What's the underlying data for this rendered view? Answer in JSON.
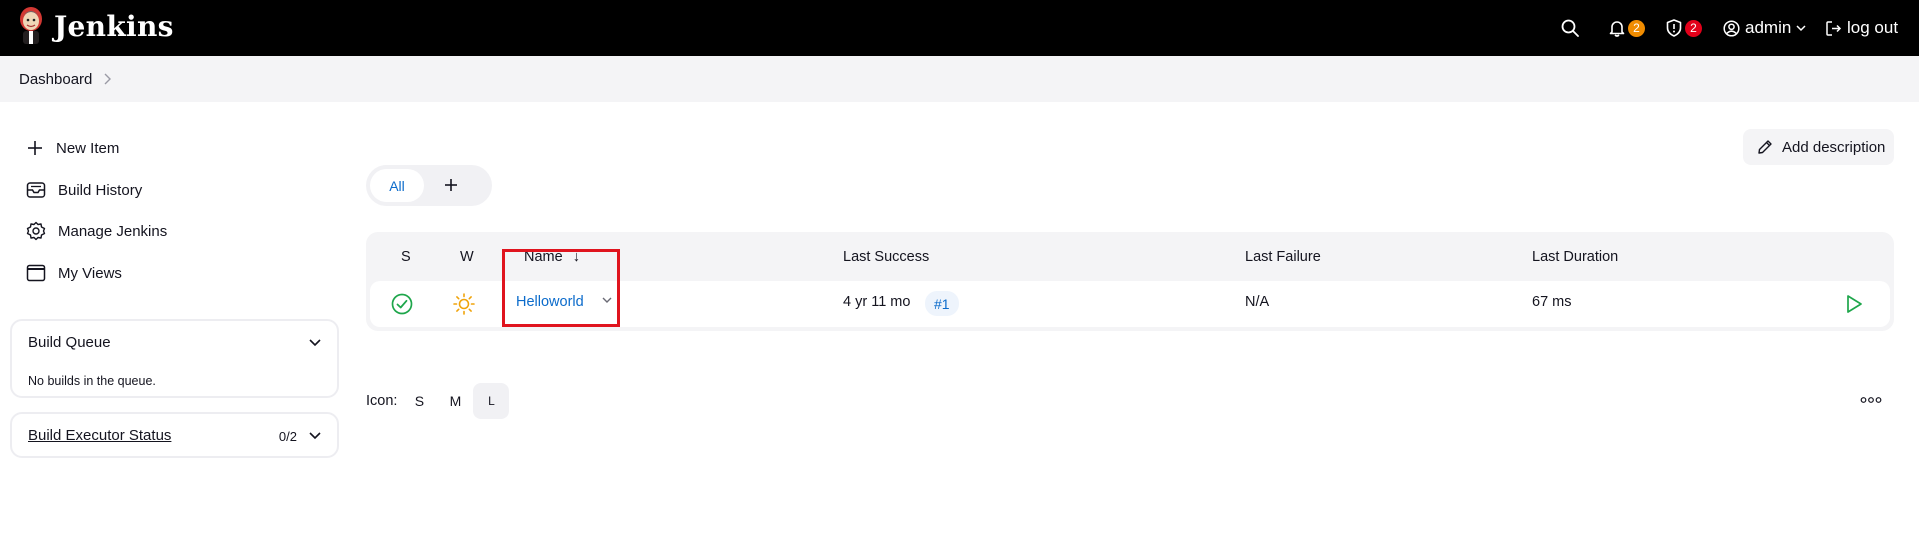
{
  "header": {
    "brand": "Jenkins",
    "notifications_count": "2",
    "security_count": "2",
    "user": "admin",
    "logout": "log out"
  },
  "breadcrumb": {
    "items": [
      "Dashboard"
    ]
  },
  "sidebar": {
    "items": [
      {
        "label": "New Item",
        "icon": "plus-icon"
      },
      {
        "label": "Build History",
        "icon": "inbox-icon"
      },
      {
        "label": "Manage Jenkins",
        "icon": "gear-icon"
      },
      {
        "label": "My Views",
        "icon": "window-icon"
      }
    ],
    "build_queue": {
      "title": "Build Queue",
      "empty_text": "No builds in the queue."
    },
    "executor_status": {
      "title": "Build Executor Status",
      "count": "0/2"
    }
  },
  "main": {
    "add_description": "Add description",
    "tabs": [
      {
        "label": "All"
      }
    ],
    "table": {
      "headers": {
        "s": "S",
        "w": "W",
        "name": "Name",
        "sort_arrow": "↓",
        "last_success": "Last Success",
        "last_failure": "Last Failure",
        "last_duration": "Last Duration"
      },
      "rows": [
        {
          "name": "Helloworld",
          "last_success": "4 yr 11 mo",
          "build": "#1",
          "last_failure": "N/A",
          "last_duration": "67 ms",
          "status": "success",
          "weather": "sunny"
        }
      ]
    },
    "icon_size": {
      "label": "Icon:",
      "options": [
        "S",
        "M",
        "L"
      ],
      "selected": "L"
    }
  },
  "colors": {
    "accent": "#0b6bcb",
    "success": "#1ea64b",
    "weather": "#f0a30a",
    "highlight": "#e0141e",
    "badge_orange": "#f08c00",
    "badge_red": "#e2001a"
  }
}
